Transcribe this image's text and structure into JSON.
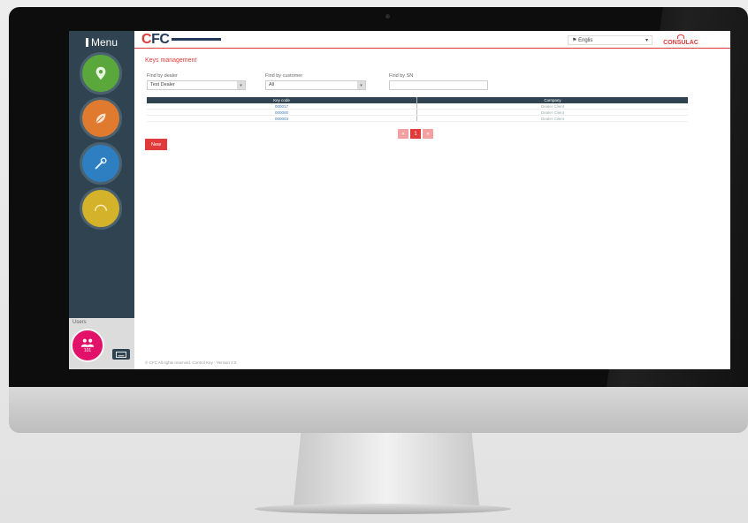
{
  "sidebar": {
    "title": "Menu",
    "nav": [
      {
        "icon": "map-pin-icon",
        "color": "#5aa83c"
      },
      {
        "icon": "leaf-icon",
        "color": "#e07a2e"
      },
      {
        "icon": "tools-icon",
        "color": "#2e7fc2"
      },
      {
        "icon": "gauge-icon",
        "color": "#d4b22a"
      }
    ],
    "user_panel": {
      "label": "Users",
      "count": "101",
      "icon": "users-icon",
      "color": "#e2126a"
    }
  },
  "header": {
    "logo_text": "CFC",
    "language": "Englis",
    "brand": "CONSULAC"
  },
  "main": {
    "title": "Keys management",
    "filters": [
      {
        "label": "Find by dealer",
        "value": "Test Dealer"
      },
      {
        "label": "Find by customer",
        "value": "All"
      },
      {
        "label": "Find by SN",
        "value": ""
      }
    ],
    "table": {
      "columns": [
        "Key code",
        "Company"
      ],
      "rows": [
        [
          "000017",
          "Dealer Client"
        ],
        [
          "000000",
          "Dealer Client"
        ],
        [
          "000003",
          "Dealer Client"
        ]
      ]
    },
    "pagination": [
      "«",
      "1",
      "»"
    ],
    "new_button": "New"
  },
  "footer": {
    "text": "© CFC All rights reserved. Control Key - Version 2.0"
  },
  "colors": {
    "accent": "#e03a3a",
    "sidebar": "#2f4450",
    "link": "#3a7ab8"
  }
}
